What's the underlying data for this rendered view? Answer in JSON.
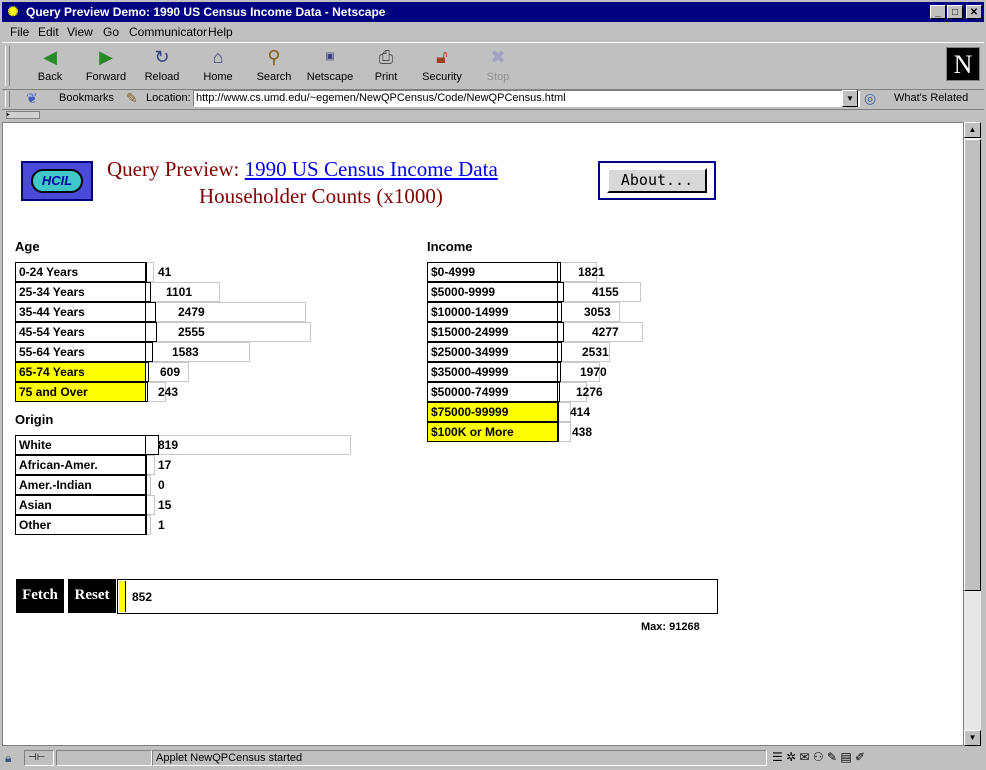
{
  "window": {
    "title": "Query Preview Demo: 1990 US Census Income Data - Netscape"
  },
  "menu": [
    "File",
    "Edit",
    "View",
    "Go",
    "Communicator",
    "Help"
  ],
  "toolbar": [
    {
      "label": "Back",
      "icon": "back-arrow-icon"
    },
    {
      "label": "Forward",
      "icon": "forward-arrow-icon"
    },
    {
      "label": "Reload",
      "icon": "reload-icon"
    },
    {
      "label": "Home",
      "icon": "home-icon"
    },
    {
      "label": "Search",
      "icon": "search-icon"
    },
    {
      "label": "Netscape",
      "icon": "netscape-icon"
    },
    {
      "label": "Print",
      "icon": "print-icon"
    },
    {
      "label": "Security",
      "icon": "lock-icon"
    },
    {
      "label": "Stop",
      "icon": "stop-icon"
    }
  ],
  "location": {
    "bookmarks_label": "Bookmarks",
    "location_label": "Location:",
    "url": "http://www.cs.umd.edu/~egemen/NewQPCensus/Code/NewQPCensus.html",
    "related_label": "What's Related"
  },
  "page": {
    "logo_text": "HCIL",
    "title_prefix": "Query Preview:",
    "title_link": "1990 US Census Income Data",
    "subtitle": "Householder Counts (x1000)",
    "about_label": "About..."
  },
  "age": {
    "heading": "Age",
    "rows": [
      {
        "label": "0-24 Years",
        "value": "41",
        "count": 41,
        "selected": false
      },
      {
        "label": "25-34 Years",
        "value": "1101",
        "count": 1101,
        "selected": false
      },
      {
        "label": "35-44 Years",
        "value": "2479",
        "count": 2479,
        "selected": false
      },
      {
        "label": "45-54 Years",
        "value": "2555",
        "count": 2555,
        "selected": false
      },
      {
        "label": "55-64 Years",
        "value": "1583",
        "count": 1583,
        "selected": false
      },
      {
        "label": "65-74 Years",
        "value": "609",
        "count": 609,
        "selected": true
      },
      {
        "label": "75 and Over",
        "value": "243",
        "count": 243,
        "selected": true
      }
    ]
  },
  "origin": {
    "heading": "Origin",
    "rows": [
      {
        "label": "White",
        "value": "819",
        "count": 819,
        "selected": false
      },
      {
        "label": "African-Amer.",
        "value": "17",
        "count": 17,
        "selected": false
      },
      {
        "label": "Amer.-Indian",
        "value": "0",
        "count": 0,
        "selected": false
      },
      {
        "label": "Asian",
        "value": "15",
        "count": 15,
        "selected": false
      },
      {
        "label": "Other",
        "value": "1",
        "count": 1,
        "selected": false
      }
    ]
  },
  "income": {
    "heading": "Income",
    "rows": [
      {
        "label": "$0-4999",
        "value": "1821",
        "count": 1821,
        "selected": false
      },
      {
        "label": "$5000-9999",
        "value": "4155",
        "count": 4155,
        "selected": false
      },
      {
        "label": "$10000-14999",
        "value": "3053",
        "count": 3053,
        "selected": false
      },
      {
        "label": "$15000-24999",
        "value": "4277",
        "count": 4277,
        "selected": false
      },
      {
        "label": "$25000-34999",
        "value": "2531",
        "count": 2531,
        "selected": false
      },
      {
        "label": "$35000-49999",
        "value": "1970",
        "count": 1970,
        "selected": false
      },
      {
        "label": "$50000-74999",
        "value": "1276",
        "count": 1276,
        "selected": false
      },
      {
        "label": "$75000-99999",
        "value": "414",
        "count": 414,
        "selected": true
      },
      {
        "label": "$100K or More",
        "value": "438",
        "count": 438,
        "selected": true
      }
    ]
  },
  "result": {
    "fetch_label": "Fetch",
    "reset_label": "Reset",
    "count_label": "852",
    "count": 852,
    "max_label": "Max: 91268",
    "max": 91268
  },
  "status": {
    "text": "Applet NewQPCensus started"
  },
  "colors": {
    "selected": "#ffff00",
    "title_dark_red": "#800000",
    "link_blue": "#0000ee",
    "titlebar": "#000080"
  }
}
